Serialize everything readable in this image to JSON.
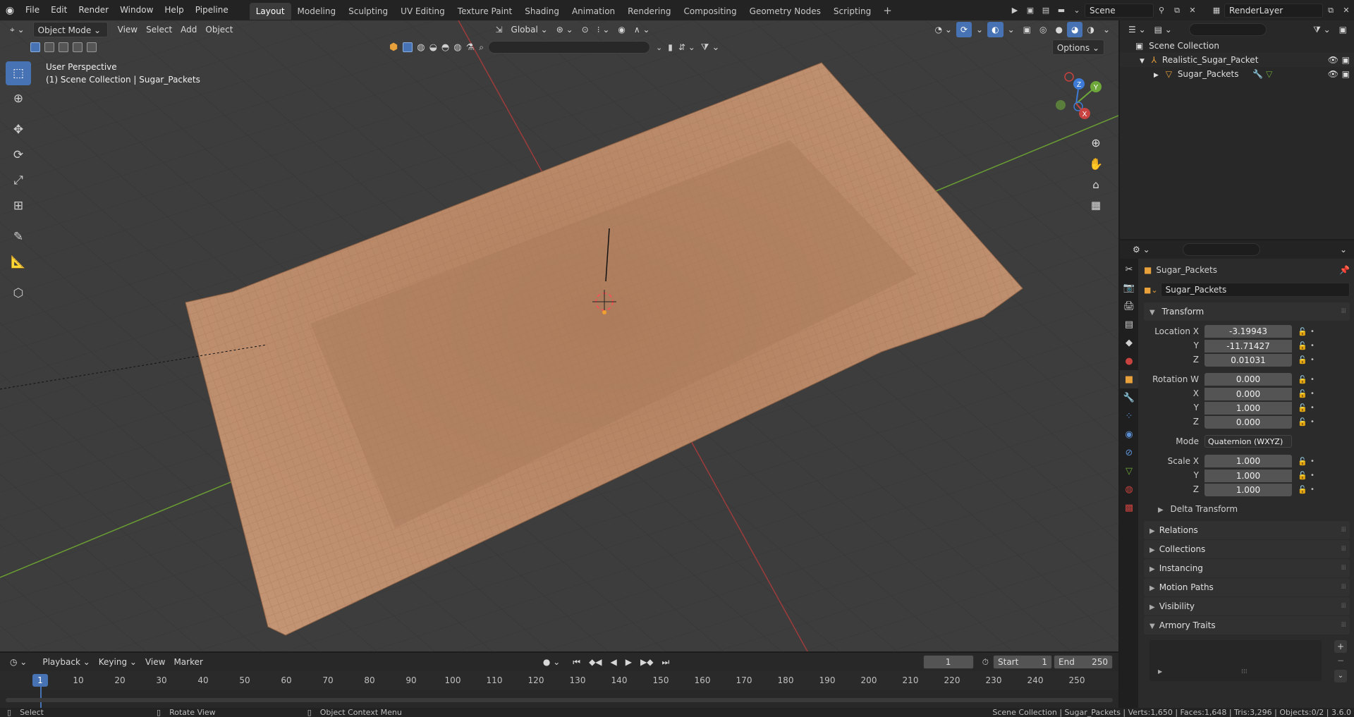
{
  "menu": [
    "File",
    "Edit",
    "Render",
    "Window",
    "Help",
    "Pipeline"
  ],
  "workspaces": [
    "Layout",
    "Modeling",
    "Sculpting",
    "UV Editing",
    "Texture Paint",
    "Shading",
    "Animation",
    "Rendering",
    "Compositing",
    "Geometry Nodes",
    "Scripting"
  ],
  "active_workspace": "Layout",
  "scene_name": "Scene",
  "render_layer": "RenderLayer",
  "viewport": {
    "mode": "Object Mode",
    "menus": [
      "View",
      "Select",
      "Add",
      "Object"
    ],
    "transform_orientation": "Global",
    "options_label": "Options",
    "perspective": "User Perspective",
    "collection_info": "(1) Scene Collection | Sugar_Packets"
  },
  "outliner": {
    "root": "Scene Collection",
    "items": [
      {
        "name": "Realistic_Sugar_Packet"
      },
      {
        "name": "Sugar_Packets"
      }
    ]
  },
  "properties": {
    "object_name": "Sugar_Packets",
    "datablock_name": "Sugar_Packets",
    "transform_title": "Transform",
    "location_label": "Location X",
    "location": {
      "x": "-3.19943",
      "y": "-11.71427",
      "z": "0.01031"
    },
    "rotation_label": "Rotation W",
    "rotation": {
      "w": "0.000",
      "x": "0.000",
      "y": "1.000",
      "z": "0.000"
    },
    "mode_label": "Mode",
    "rotation_mode": "Quaternion (WXYZ)",
    "scale_label": "Scale X",
    "scale": {
      "x": "1.000",
      "y": "1.000",
      "z": "1.000"
    },
    "axis_labels": {
      "x": "X",
      "y": "Y",
      "z": "Z"
    },
    "panels": [
      "Relations",
      "Collections",
      "Instancing",
      "Motion Paths",
      "Visibility"
    ],
    "delta_transform": "Delta Transform",
    "armory_traits": "Armory Traits"
  },
  "timeline": {
    "menus": [
      "Playback",
      "Keying",
      "View",
      "Marker"
    ],
    "current_frame": "1",
    "start_label": "Start",
    "start": "1",
    "end_label": "End",
    "end": "250",
    "ticks": [
      "10",
      "20",
      "30",
      "40",
      "50",
      "60",
      "70",
      "80",
      "90",
      "100",
      "110",
      "120",
      "130",
      "140",
      "150",
      "160",
      "170",
      "180",
      "190",
      "200",
      "210",
      "220",
      "230",
      "240",
      "250"
    ]
  },
  "statusbar": {
    "select": "Select",
    "rotate": "Rotate View",
    "context": "Object Context Menu",
    "stats": "Scene Collection | Sugar_Packets | Verts:1,650 | Faces:1,648 | Tris:3,296 | Objects:0/2 | 3.6.0"
  },
  "colors": {
    "accent": "#4772b3",
    "x_axis": "#c8423f",
    "y_axis": "#6ea83a",
    "z_axis": "#3d7bd6",
    "packet": "#b98a6a"
  }
}
